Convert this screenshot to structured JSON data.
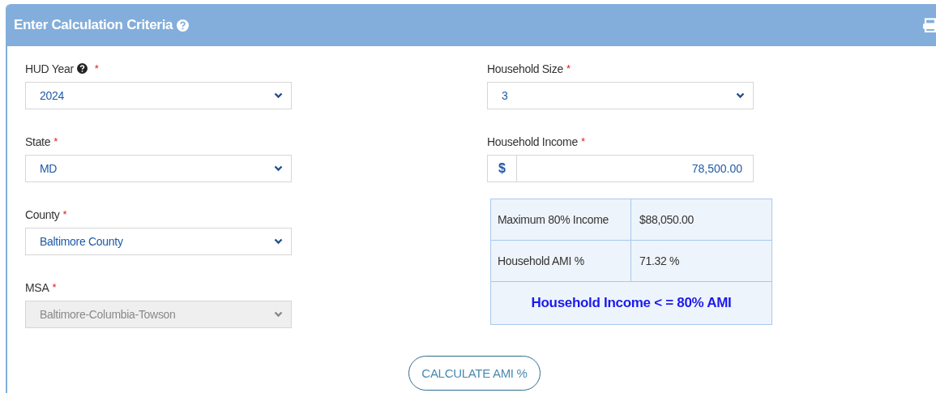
{
  "panel": {
    "title": "Enter Calculation Criteria"
  },
  "left_fields": [
    {
      "kind": "select",
      "label": "HUD Year",
      "help": true,
      "required_mark": "*",
      "value": "2024",
      "disabled": false
    },
    {
      "kind": "select",
      "label": "State",
      "help": false,
      "required_mark": "*",
      "value": "MD",
      "disabled": false
    },
    {
      "kind": "select",
      "label": "County",
      "help": false,
      "required_mark": "*",
      "value": "Baltimore County",
      "disabled": false
    },
    {
      "kind": "select",
      "label": "MSA",
      "help": false,
      "required_mark": "*",
      "value": "Baltimore-Columbia-Towson",
      "disabled": true
    }
  ],
  "right_fields": [
    {
      "kind": "select",
      "label": "Household Size",
      "help": false,
      "required_mark": "*",
      "value": "3",
      "disabled": false
    },
    {
      "kind": "currency",
      "label": "Household Income",
      "help": false,
      "required_mark": "*",
      "prefix": "$",
      "value": "78,500.00",
      "disabled": false
    }
  ],
  "result": {
    "rows": [
      {
        "label": "Maximum 80% Income",
        "value": "$88,050.00"
      },
      {
        "label": "Household AMI %",
        "value": "71.32 %"
      }
    ],
    "verdict": "Household Income < = 80% AMI"
  },
  "button": "CALCULATE AMI %"
}
